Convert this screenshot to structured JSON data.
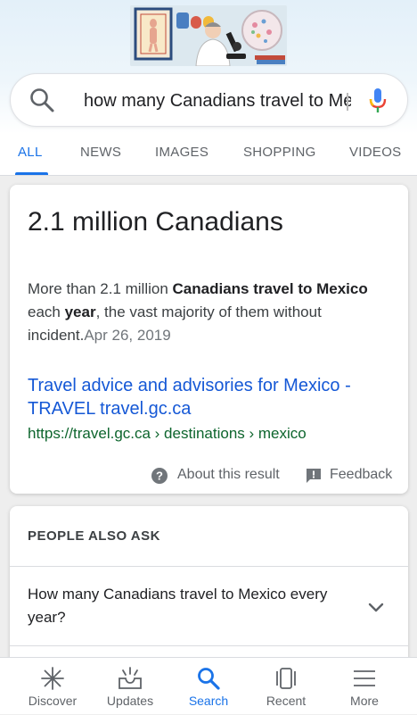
{
  "search": {
    "query": "how many Canadians travel to Mexico every year"
  },
  "tabs": [
    {
      "label": "ALL",
      "active": true
    },
    {
      "label": "NEWS"
    },
    {
      "label": "IMAGES"
    },
    {
      "label": "SHOPPING"
    },
    {
      "label": "VIDEOS"
    }
  ],
  "answer": {
    "title": "2.1 million Canadians",
    "snippet_part1": "More than 2.1 million ",
    "snippet_bold1": "Canadians travel to Mexico",
    "snippet_part2": " each ",
    "snippet_bold2": "year",
    "snippet_part3": ", the vast majority of them without incident.",
    "date": "Apr 26, 2019",
    "link_title": "Travel advice and advisories for Mexico - TRAVEL travel.gc.ca",
    "link_url": "https://travel.gc.ca › destinations › mexico",
    "about_label": "About this result",
    "feedback_label": "Feedback"
  },
  "people_also_ask": {
    "heading": "PEOPLE ALSO ASK",
    "questions": [
      "How many Canadians travel to Mexico every year?"
    ]
  },
  "bottom_nav": [
    {
      "label": "Discover",
      "icon": "asterisk-icon"
    },
    {
      "label": "Updates",
      "icon": "updates-tray-icon"
    },
    {
      "label": "Search",
      "icon": "search-icon",
      "active": true
    },
    {
      "label": "Recent",
      "icon": "recent-cards-icon"
    },
    {
      "label": "More",
      "icon": "menu-icon"
    }
  ],
  "colors": {
    "accent": "#1a73e8",
    "link": "#1558d6",
    "url_green": "#0d652d"
  }
}
